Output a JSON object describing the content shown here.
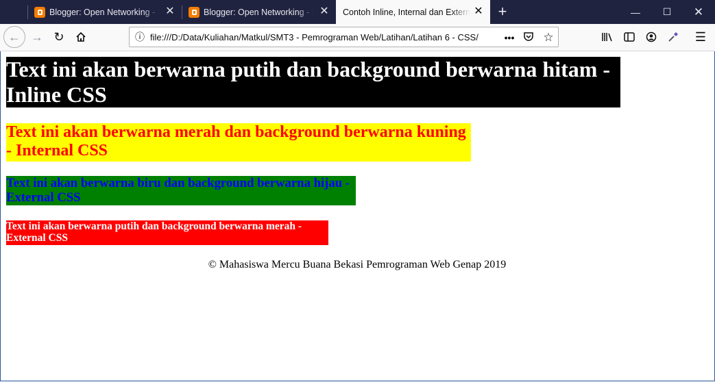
{
  "browser": {
    "tabs": [
      {
        "title": "Blogger: Open Networking - Se",
        "active": false
      },
      {
        "title": "Blogger: Open Networking - Ed",
        "active": false
      },
      {
        "title": "Contoh Inline, Internal dan External",
        "active": true
      }
    ],
    "url": "file:///D:/Data/Kuliahan/Matkul/SMT3 - Pemrograman Web/Latihan/Latihan 6 - CSS/"
  },
  "page": {
    "inline_heading": "Text ini akan berwarna putih dan background berwarna hitam - Inline CSS",
    "internal_heading": "Text ini akan berwarna merah dan background berwarna kuning - Internal CSS",
    "external_heading_blue": "Text ini akan berwarna biru dan background berwarna hijau - External CSS",
    "external_heading_red": "Text ini akan berwarna putih dan background berwarna merah - External CSS",
    "footer": "© Mahasiswa Mercu Buana Bekasi Pemrograman Web Genap 2019"
  },
  "colors": {
    "tabbar_bg": "#202340",
    "inline_bg": "#000000",
    "inline_fg": "#ffffff",
    "internal_bg": "#ffff00",
    "internal_fg": "#ff0000",
    "ext_blue_bg": "#008000",
    "ext_blue_fg": "#0000ff",
    "ext_red_bg": "#ff0000",
    "ext_red_fg": "#ffffff"
  }
}
